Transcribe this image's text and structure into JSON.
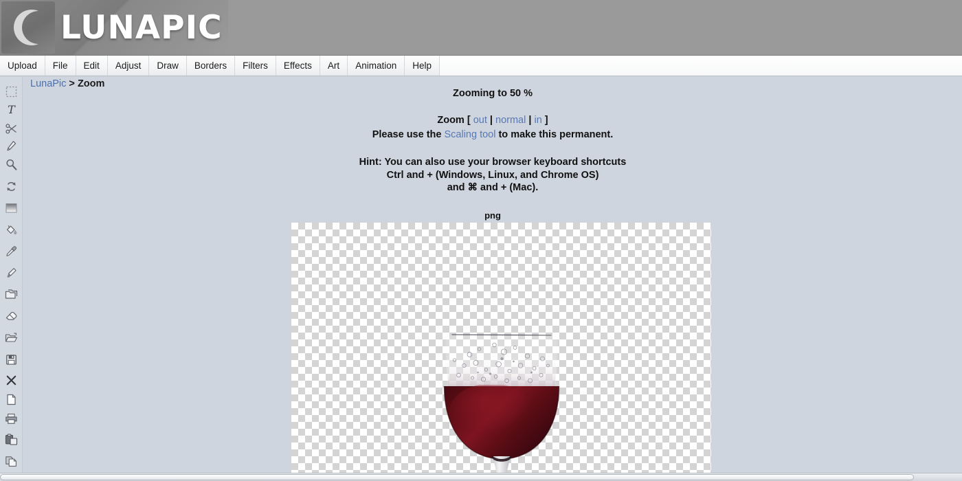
{
  "app": {
    "brand": "LUNAPIC",
    "logo_icon": "crescent-moon-icon"
  },
  "menubar": {
    "items": [
      {
        "label": "Upload"
      },
      {
        "label": "File"
      },
      {
        "label": "Edit"
      },
      {
        "label": "Adjust"
      },
      {
        "label": "Draw"
      },
      {
        "label": "Borders"
      },
      {
        "label": "Filters"
      },
      {
        "label": "Effects"
      },
      {
        "label": "Art"
      },
      {
        "label": "Animation"
      },
      {
        "label": "Help"
      }
    ]
  },
  "sidebar": {
    "tools": [
      {
        "name": "selection-marquee-icon",
        "title": "Selection"
      },
      {
        "name": "text-icon",
        "title": "Text"
      },
      {
        "name": "scissors-icon",
        "title": "Crop"
      },
      {
        "name": "pencil-icon",
        "title": "Pencil"
      },
      {
        "name": "magnifier-icon",
        "title": "Zoom"
      },
      {
        "name": "rotate-icon",
        "title": "Rotate"
      },
      {
        "name": "gradient-icon",
        "title": "Gradient"
      },
      {
        "name": "paint-bucket-icon",
        "title": "Fill"
      },
      {
        "name": "eyedropper-icon",
        "title": "Color Picker"
      },
      {
        "name": "brush-icon",
        "title": "Brush"
      },
      {
        "name": "layers-icon",
        "title": "Layers"
      },
      {
        "name": "eraser-icon",
        "title": "Eraser"
      },
      {
        "name": "open-folder-icon",
        "title": "Open"
      },
      {
        "name": "save-floppy-icon",
        "title": "Save"
      },
      {
        "name": "close-x-icon",
        "title": "Close"
      },
      {
        "name": "new-page-icon",
        "title": "New"
      },
      {
        "name": "printer-icon",
        "title": "Print"
      },
      {
        "name": "paste-icon",
        "title": "Paste"
      },
      {
        "name": "copy-icon",
        "title": "Copy"
      }
    ]
  },
  "breadcrumb": {
    "root": "LunaPic",
    "separator": " > ",
    "current": "Zoom"
  },
  "main": {
    "status": "Zooming to 50 %",
    "zoom_percent": 50,
    "zoom_prefix": "Zoom [ ",
    "zoom_out": "out",
    "zoom_sep1": " | ",
    "zoom_normal": "normal",
    "zoom_sep2": " | ",
    "zoom_in": "in",
    "zoom_suffix": " ]",
    "scaling_prefix": "Please use the ",
    "scaling_link": "Scaling tool",
    "scaling_suffix": " to make this permanent.",
    "hint_line1": "Hint: You can also use your browser keyboard shortcuts",
    "hint_line2": "Ctrl and + (Windows, Linux, and Chrome OS)",
    "hint_line3": "and ⌘ and + (Mac).",
    "file_type": "png"
  },
  "image": {
    "alt": "wine-glass-with-red-wine",
    "wine_color": "#5e0d15",
    "wine_highlight": "#8a1622",
    "wine_dark": "#37060c"
  },
  "colors": {
    "page_background": "#ced5de",
    "header_gray": "#9a9a9a",
    "link_blue": "#5878b4",
    "menubar_background": "#f7f8f9",
    "sidebar_background": "#d3d9e1"
  }
}
